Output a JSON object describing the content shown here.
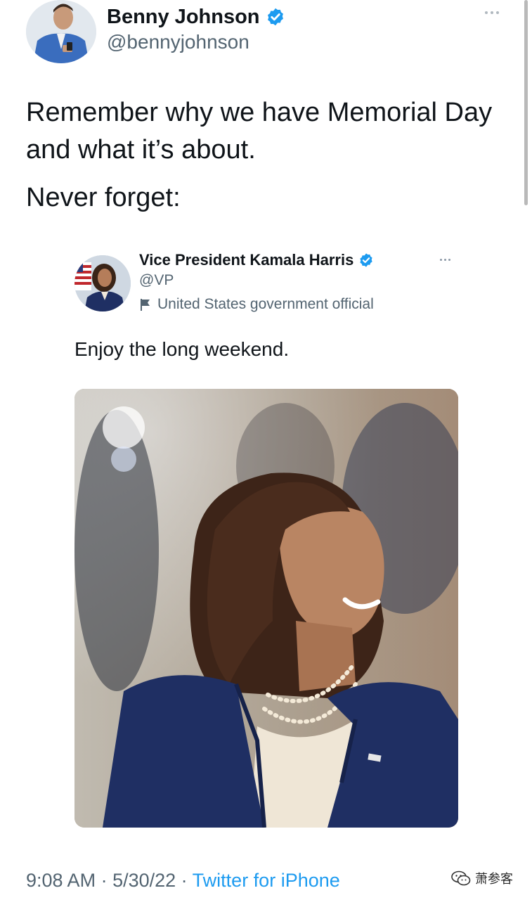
{
  "outer_tweet": {
    "author_name": "Benny Johnson",
    "handle": "@bennyjohnson",
    "text_line1": "Remember why we have Memorial Day and what it’s about.",
    "text_line2": "Never forget:",
    "avatar_icon": "profile-photo",
    "verified_icon": "verified-badge-icon",
    "more_icon": "more-options-icon"
  },
  "quoted_screenshot": {
    "author_name": "Vice President Kamala Harris",
    "handle": "@VP",
    "label": "United States government official",
    "label_icon": "government-flag-icon",
    "text": "Enjoy the long weekend.",
    "photo_icon": "portrait-photo"
  },
  "footer": {
    "time": "9:08 AM",
    "sep1": " · ",
    "date": "5/30/22",
    "sep2": " · ",
    "source": "Twitter for iPhone"
  },
  "watermark": {
    "text": "萧参客",
    "icon": "wechat-icon"
  },
  "colors": {
    "text_primary": "#0f1419",
    "text_secondary": "#536471",
    "accent_blue": "#1d9bf0",
    "suit_navy": "#1f2f63"
  }
}
